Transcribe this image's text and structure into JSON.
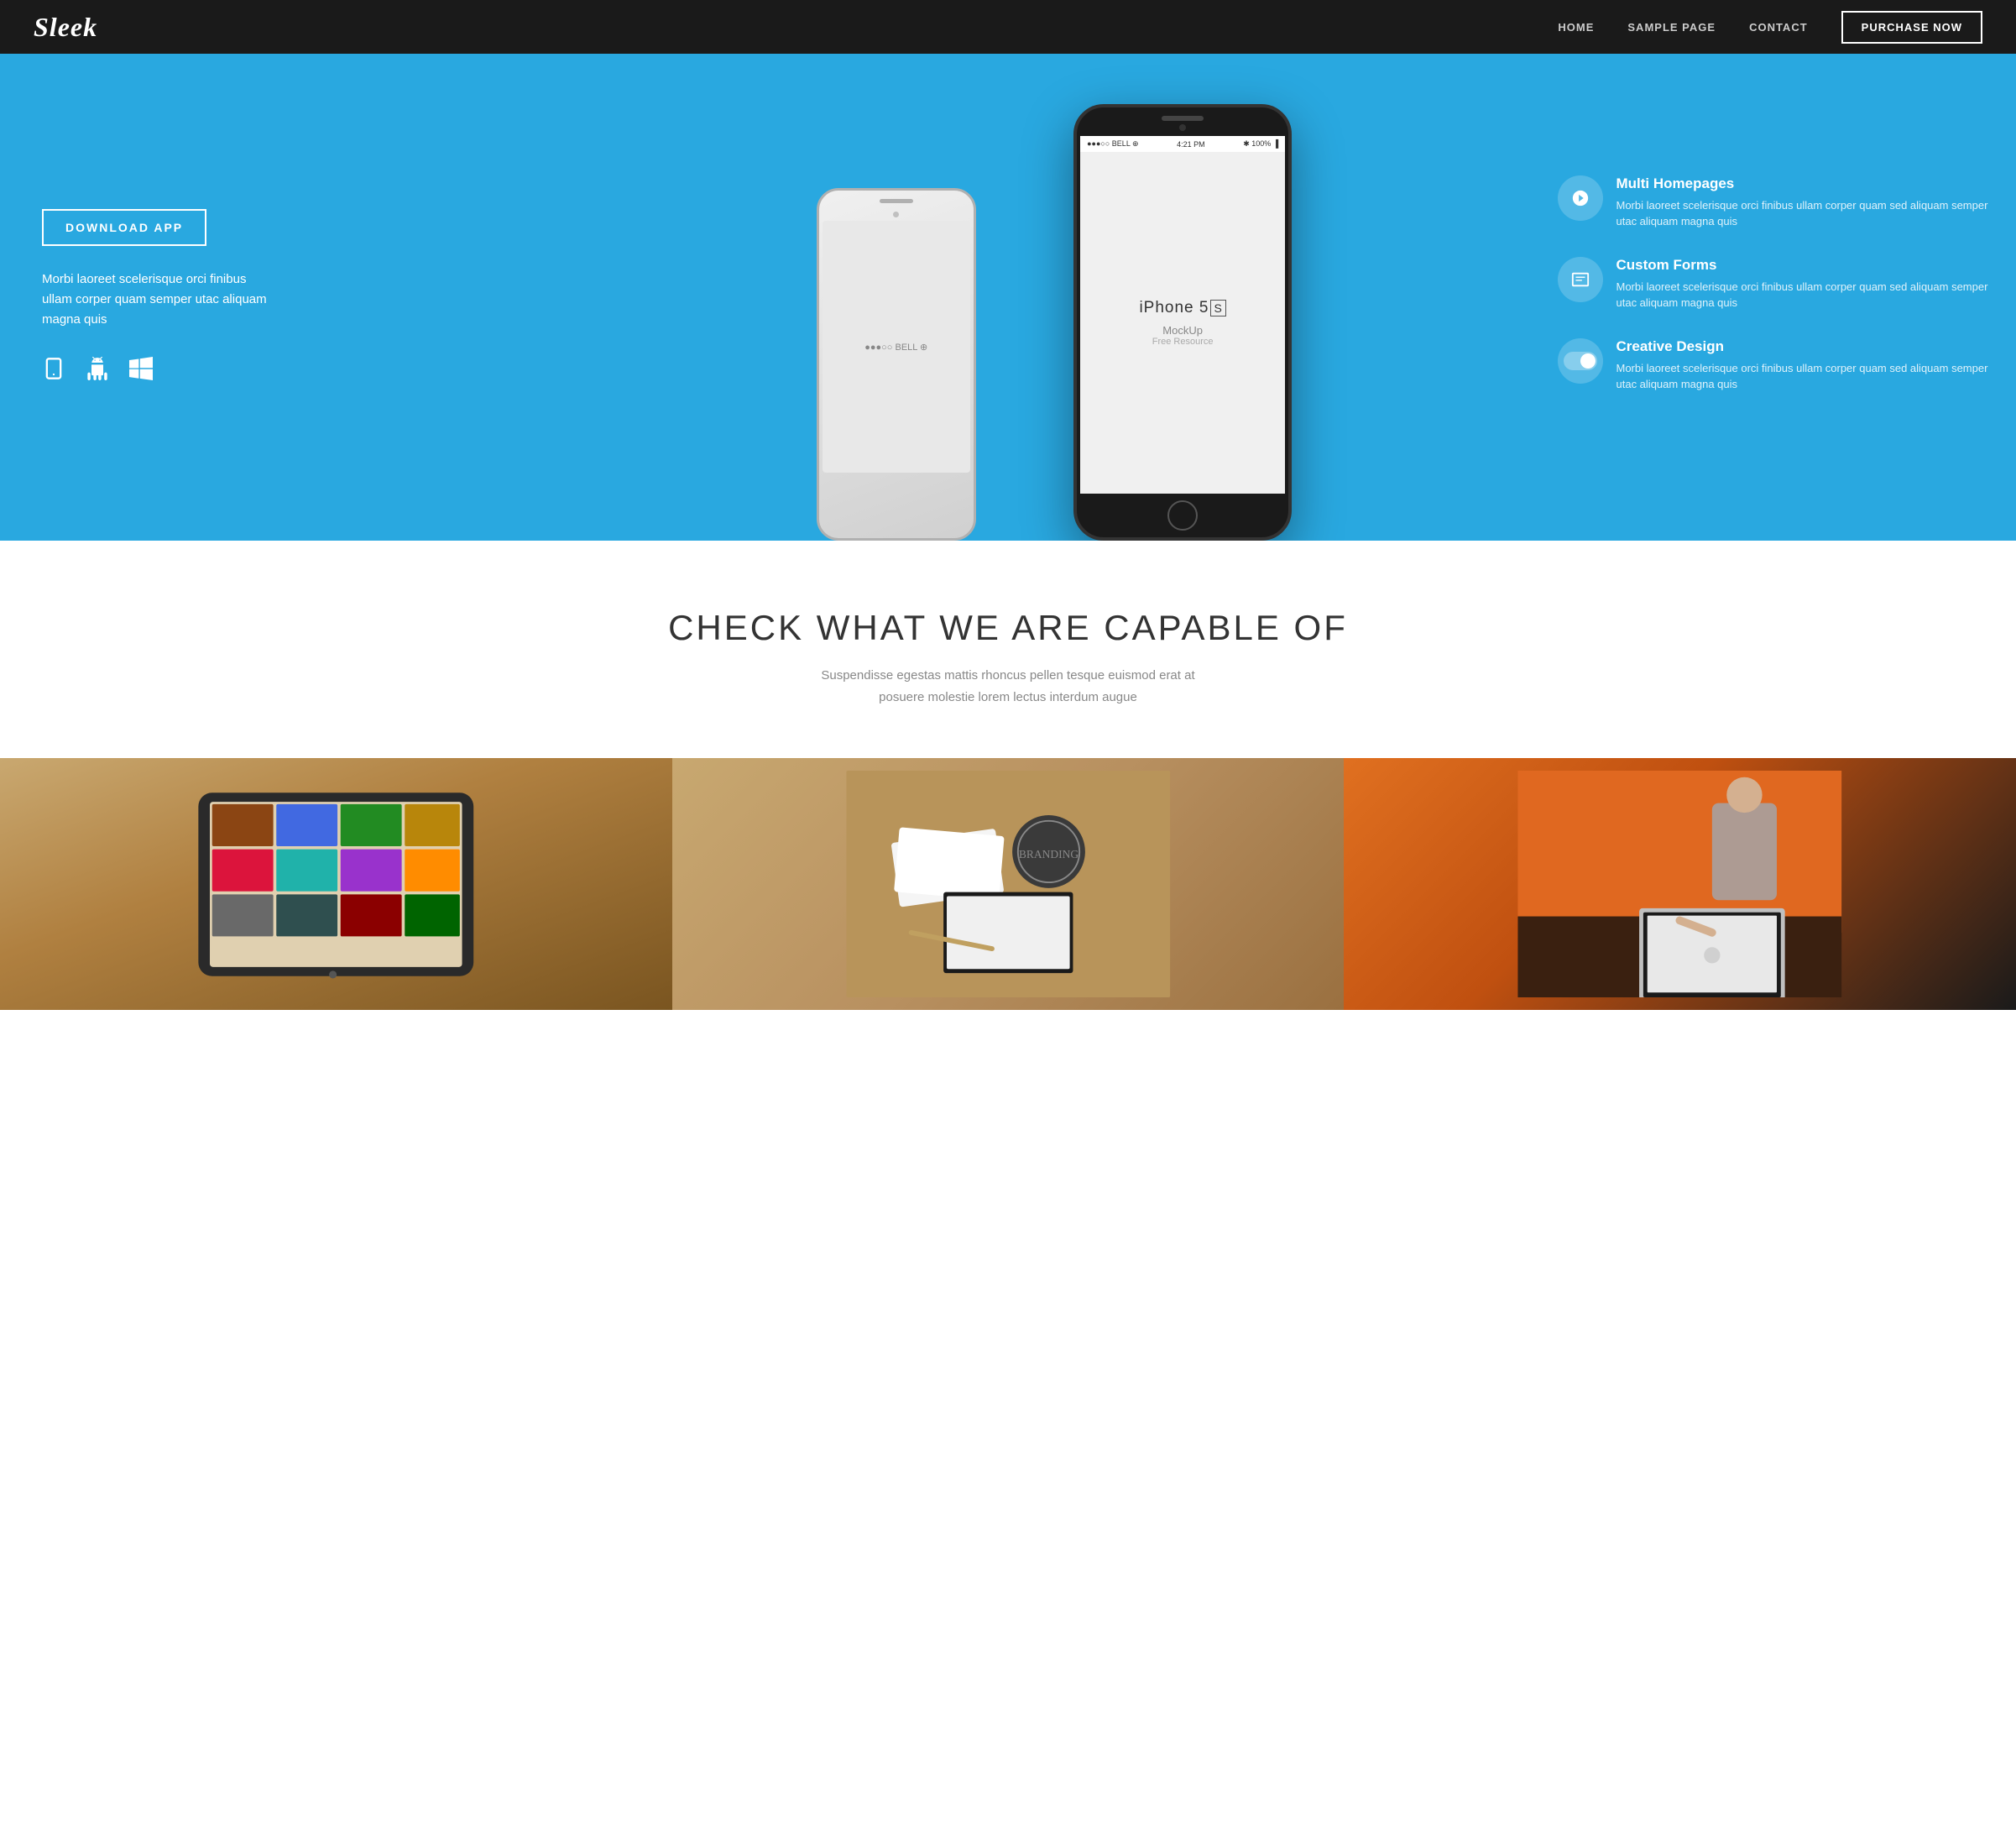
{
  "navbar": {
    "logo": "Sleek",
    "nav": {
      "home": "HOME",
      "sample_page": "SAMPLE PAGE",
      "contact": "CONTACT",
      "purchase": "PURCHASE NOW"
    }
  },
  "hero": {
    "download_btn": "DOWNLOAD APP",
    "description": "Morbi laoreet scelerisque orci finibus ullam corper quam semper utac aliquam magna quis",
    "platforms": [
      "mobile",
      "android",
      "windows"
    ],
    "phone": {
      "status_left": "●●●○○ BELL ⊕",
      "status_time": "4:21 PM",
      "status_right": "✱ 100% ▐",
      "model_name": "iPhone 5",
      "model_sub": "MockUp",
      "model_sub2": "Free Resource",
      "status_left2": "●●●○○ BELL ⊕"
    },
    "features": [
      {
        "icon": "✦",
        "title": "Multi Homepages",
        "description": "Morbi laoreet scelerisque orci finibus ullam corper quam sed aliquam semper utac aliquam magna quis"
      },
      {
        "icon": "▭",
        "title": "Custom Forms",
        "description": "Morbi laoreet scelerisque orci finibus ullam corper quam sed aliquam semper utac aliquam magna quis"
      },
      {
        "icon": "toggle",
        "title": "Creative Design",
        "description": "Morbi laoreet scelerisque orci finibus ullam corper quam sed aliquam semper utac aliquam magna quis"
      }
    ]
  },
  "capabilities": {
    "heading": "CHECK WHAT WE ARE CAPABLE OF",
    "subtext": "Suspendisse egestas mattis rhoncus pellen tesque euismod erat at\nposuere molestie lorem lectus interdum augue"
  },
  "portfolio": [
    {
      "type": "tablet",
      "alt": "Tablet showcase"
    },
    {
      "type": "branding",
      "alt": "Branding materials"
    },
    {
      "type": "office",
      "alt": "Office workspace"
    }
  ],
  "colors": {
    "nav_bg": "#1a1a1a",
    "hero_bg": "#29a8e0",
    "white": "#ffffff",
    "dark": "#333333",
    "gray": "#888888"
  }
}
